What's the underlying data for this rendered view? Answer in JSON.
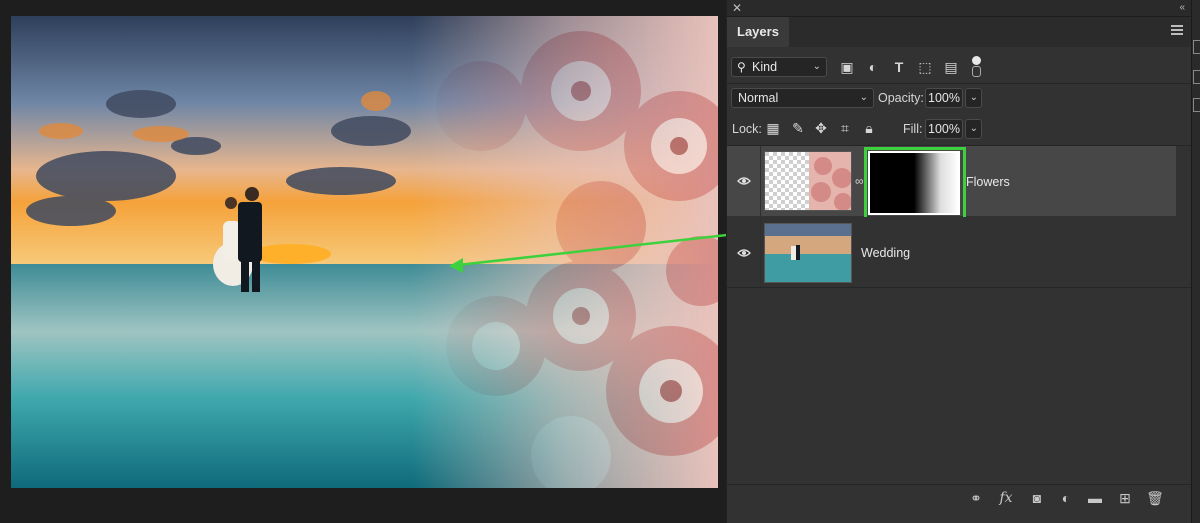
{
  "panel": {
    "tab_label": "Layers",
    "filter": {
      "value": "Kind"
    },
    "blend_mode": {
      "value": "Normal"
    },
    "opacity": {
      "label": "Opacity:",
      "value": "100%"
    },
    "lock": {
      "label": "Lock:"
    },
    "fill": {
      "label": "Fill:",
      "value": "100%"
    },
    "layers": [
      {
        "name": "Flowers",
        "visible": true,
        "selected": true,
        "has_mask": true
      },
      {
        "name": "Wedding",
        "visible": true,
        "selected": false,
        "has_mask": false
      }
    ],
    "bottom_icons": [
      "link-icon",
      "fx-icon",
      "add-mask-icon",
      "adjustment-icon",
      "folder-icon",
      "new-layer-icon",
      "trash-icon"
    ]
  },
  "colors": {
    "highlight": "#3dd13d",
    "panel_bg": "#323232",
    "selected_row": "#444444"
  }
}
